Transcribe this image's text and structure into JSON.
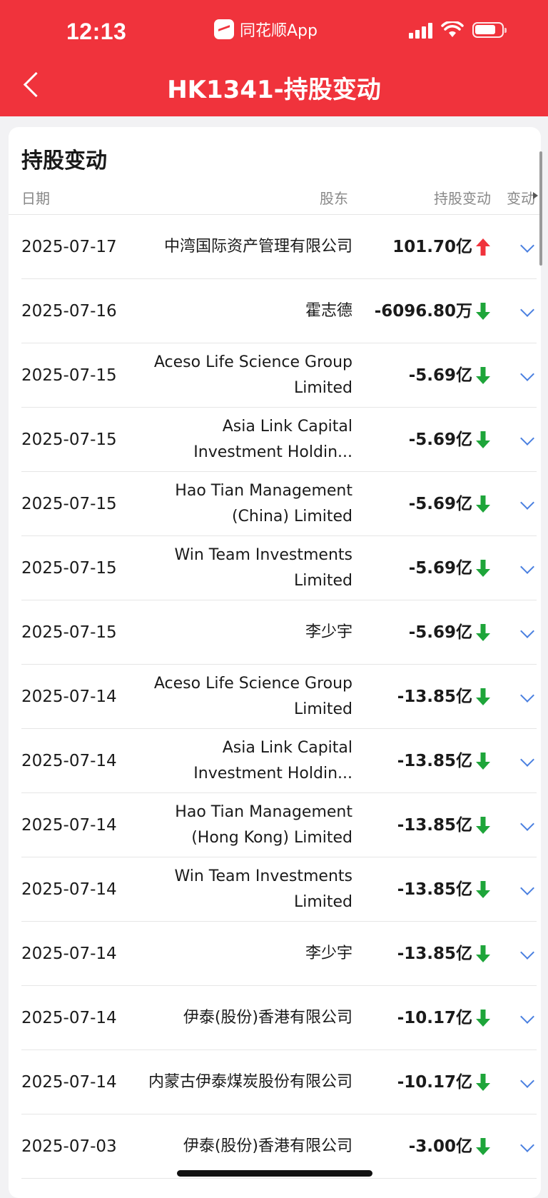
{
  "status_bar": {
    "time": "12:13",
    "app_name": "同花顺App"
  },
  "nav": {
    "title": "HK1341-持股变动",
    "back_icon": "chevron-left-icon"
  },
  "section": {
    "title": "持股变动",
    "columns": {
      "date": "日期",
      "holder": "股东",
      "change": "持股变动",
      "more": "变动"
    }
  },
  "colors": {
    "brand_red": "#f0333c",
    "up": "#f0333c",
    "down": "#1ea53a",
    "chevron": "#4a7fe0"
  },
  "rows": [
    {
      "date": "2025-07-17",
      "holder": "中湾国际资产管理有限公司",
      "change": "101.70亿",
      "direction": "up"
    },
    {
      "date": "2025-07-16",
      "holder": "霍志德",
      "change": "-6096.80万",
      "direction": "down"
    },
    {
      "date": "2025-07-15",
      "holder": "Aceso Life Science Group Limited",
      "change": "-5.69亿",
      "direction": "down"
    },
    {
      "date": "2025-07-15",
      "holder": "Asia Link Capital Investment Holdin...",
      "change": "-5.69亿",
      "direction": "down"
    },
    {
      "date": "2025-07-15",
      "holder": "Hao Tian Management (China) Limited",
      "change": "-5.69亿",
      "direction": "down"
    },
    {
      "date": "2025-07-15",
      "holder": "Win Team Investments Limited",
      "change": "-5.69亿",
      "direction": "down"
    },
    {
      "date": "2025-07-15",
      "holder": "李少宇",
      "change": "-5.69亿",
      "direction": "down"
    },
    {
      "date": "2025-07-14",
      "holder": "Aceso Life Science Group Limited",
      "change": "-13.85亿",
      "direction": "down"
    },
    {
      "date": "2025-07-14",
      "holder": "Asia Link Capital Investment Holdin...",
      "change": "-13.85亿",
      "direction": "down"
    },
    {
      "date": "2025-07-14",
      "holder": "Hao Tian Management (Hong Kong) Limited",
      "change": "-13.85亿",
      "direction": "down"
    },
    {
      "date": "2025-07-14",
      "holder": "Win Team Investments Limited",
      "change": "-13.85亿",
      "direction": "down"
    },
    {
      "date": "2025-07-14",
      "holder": "李少宇",
      "change": "-13.85亿",
      "direction": "down"
    },
    {
      "date": "2025-07-14",
      "holder": "伊泰(股份)香港有限公司",
      "change": "-10.17亿",
      "direction": "down"
    },
    {
      "date": "2025-07-14",
      "holder": "内蒙古伊泰煤炭股份有限公司",
      "change": "-10.17亿",
      "direction": "down"
    },
    {
      "date": "2025-07-03",
      "holder": "伊泰(股份)香港有限公司",
      "change": "-3.00亿",
      "direction": "down"
    }
  ]
}
